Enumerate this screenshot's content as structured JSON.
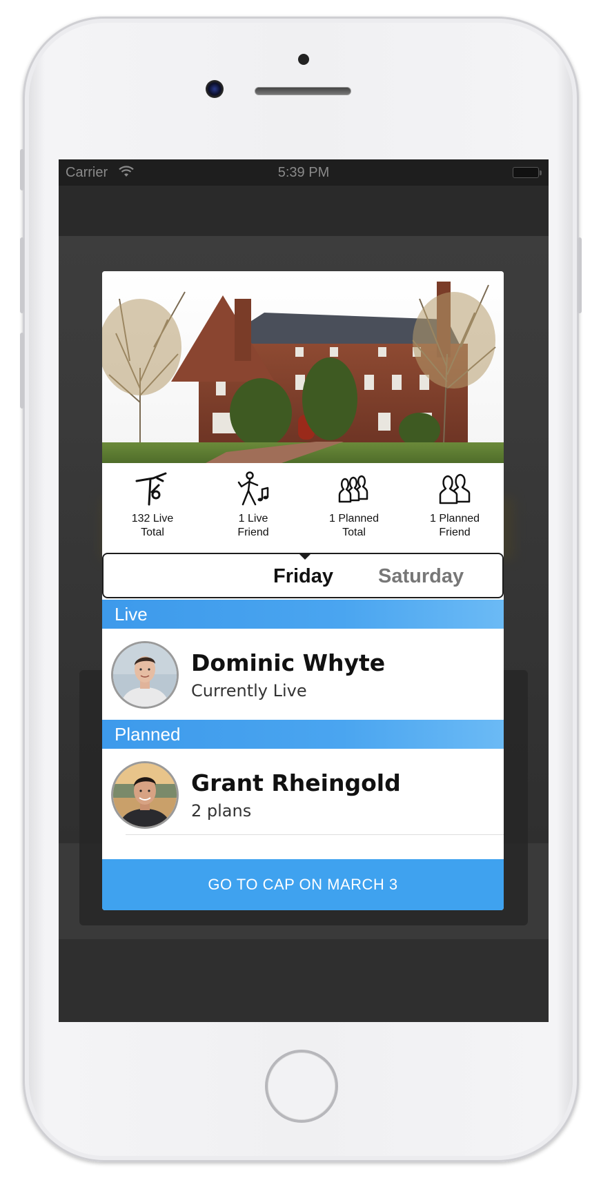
{
  "status_bar": {
    "carrier": "Carrier",
    "time": "5:39 PM"
  },
  "stats": [
    {
      "icon": "dancer-live-icon",
      "label": "132 Live\nTotal"
    },
    {
      "icon": "dancer-friend-icon",
      "label": "1 Live\nFriend"
    },
    {
      "icon": "group-planned-icon",
      "label": "1 Planned\nTotal"
    },
    {
      "icon": "friends-planned-icon",
      "label": "1 Planned\nFriend"
    }
  ],
  "days": {
    "selected": "Friday",
    "other": "Saturday"
  },
  "sections": {
    "live": {
      "header": "Live",
      "person": {
        "name": "Dominic Whyte",
        "status": "Currently Live"
      }
    },
    "planned": {
      "header": "Planned",
      "person": {
        "name": "Grant Rheingold",
        "status": "2 plans"
      }
    }
  },
  "cta_label": "GO TO CAP ON MARCH 3",
  "colors": {
    "accent_blue": "#3fa2ef",
    "section_blue": "#4aa5f0",
    "overlay": "#3a3a3a"
  }
}
